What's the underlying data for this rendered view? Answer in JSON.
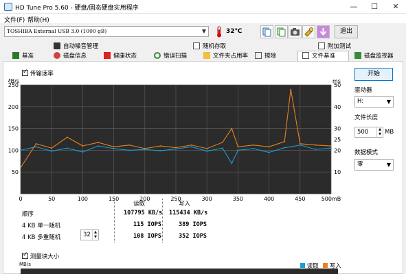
{
  "window": {
    "title": "HD Tune Pro 5.60 - 硬盘/固态硬盘实用程序",
    "minimize": "—",
    "maximize": "☐",
    "close": "✕"
  },
  "menu": [
    "文件(F)",
    "帮助(H)"
  ],
  "toolbar": {
    "drive": "TOSHIBA External USB 3.0 (1000 gB)",
    "temperature": "32℃",
    "exit_label": "退出"
  },
  "tabs": {
    "row1": [
      "自动噪音管理",
      "随机存取",
      "附加测试"
    ],
    "row2": [
      "基准",
      "磁盘信息",
      "健康状态",
      "错误扫描",
      "文件夹占用率",
      "擦除",
      "文件基准",
      "磁盘监视器"
    ],
    "active": "文件基准"
  },
  "benchmark": {
    "transfer_rate_label": "传输速率",
    "start_label": "开始",
    "drive_label": "驱动器",
    "drive_value": "H:",
    "file_length_label": "文件长度",
    "file_length_value": "500",
    "file_length_unit": "MB",
    "data_mode_label": "数据模式",
    "data_mode_value": "零",
    "block_size_label": "测量块大小",
    "results_header": [
      "读取",
      "写入"
    ],
    "results": [
      {
        "label": "顺序",
        "read": "107795 KB/s",
        "write": "115434 KB/s"
      },
      {
        "label": "4 KB 单一随机",
        "read": "115 IOPS",
        "write": "389 IOPS"
      },
      {
        "label": "4 KB 多重随机",
        "read": "108 IOPS",
        "write": "352 IOPS"
      }
    ],
    "queue_depth": "32"
  },
  "bottom_chart": {
    "ylabel": "MB/s",
    "legend": [
      "读取",
      "写入"
    ]
  },
  "chart_data": {
    "type": "line",
    "x": [
      0,
      25,
      50,
      75,
      100,
      125,
      150,
      175,
      200,
      225,
      250,
      275,
      300,
      325,
      340,
      350,
      375,
      400,
      425,
      435,
      450,
      475,
      500
    ],
    "xticks": [
      0,
      50,
      100,
      150,
      200,
      250,
      300,
      350,
      400,
      450,
      "500mB"
    ],
    "ylabel_left": "MB/s",
    "ylabel_right": "ms",
    "ylim": [
      0,
      250
    ],
    "ylim_right": [
      0,
      50
    ],
    "yticks_left": [
      50,
      100,
      150,
      200,
      250
    ],
    "yticks_right": [
      10,
      20,
      25,
      30,
      40,
      50
    ],
    "grid": true,
    "series": [
      {
        "name": "读取",
        "color": "#1a9ed6",
        "values": [
          100,
          108,
          98,
          105,
          96,
          110,
          104,
          100,
          102,
          99,
          103,
          108,
          98,
          105,
          70,
          100,
          104,
          95,
          106,
          108,
          112,
          102,
          105
        ]
      },
      {
        "name": "写入",
        "color": "#e8821e",
        "values": [
          60,
          115,
          105,
          130,
          110,
          118,
          108,
          112,
          104,
          110,
          106,
          112,
          104,
          118,
          150,
          108,
          112,
          108,
          120,
          240,
          115,
          112,
          110
        ]
      }
    ]
  },
  "colors": {
    "read": "#1a9ed6",
    "write": "#e8821e",
    "chart_bg": "#2b2b2b",
    "grid": "#5a5a5a"
  }
}
